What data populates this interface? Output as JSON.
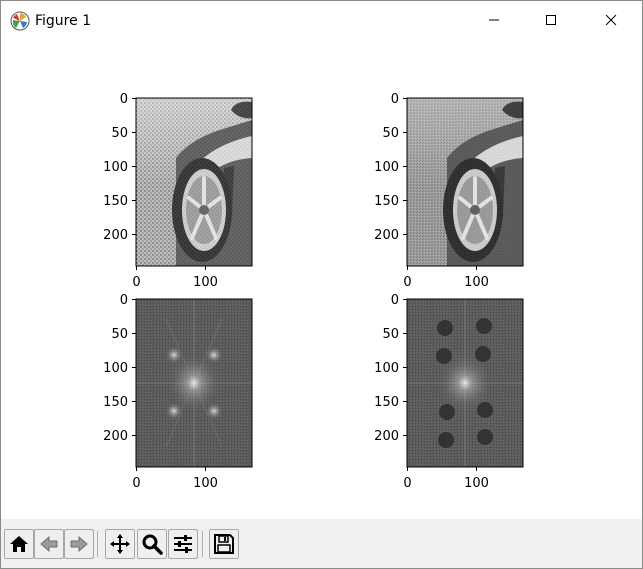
{
  "window": {
    "title": "Figure 1",
    "icons": {
      "app": "matplotlib-logo-icon",
      "minimize": "minimize-icon",
      "maximize": "maximize-icon",
      "close": "close-icon"
    }
  },
  "figure": {
    "subplots": [
      {
        "id": "original-image",
        "content": "grayscale photo of a car wheel with halftone noise pattern",
        "xticks": [
          "0",
          "100"
        ],
        "yticks": [
          "0",
          "50",
          "100",
          "150",
          "200"
        ]
      },
      {
        "id": "filtered-image",
        "content": "grayscale photo of a car wheel with noise reduced",
        "xticks": [
          "0",
          "100"
        ],
        "yticks": [
          "0",
          "50",
          "100",
          "150",
          "200"
        ]
      },
      {
        "id": "spectrum",
        "content": "Fourier magnitude spectrum with bright peaks",
        "xticks": [
          "0",
          "100"
        ],
        "yticks": [
          "0",
          "50",
          "100",
          "150",
          "200"
        ]
      },
      {
        "id": "masked-spectrum",
        "content": "Fourier spectrum with dark notch-filter circles",
        "xticks": [
          "0",
          "100"
        ],
        "yticks": [
          "0",
          "50",
          "100",
          "150",
          "200"
        ]
      }
    ],
    "colors": {
      "axes": "#000000",
      "background": "#ffffff"
    }
  },
  "toolbar": {
    "buttons": [
      {
        "name": "home-button",
        "icon": "home-icon"
      },
      {
        "name": "back-button",
        "icon": "back-arrow-icon"
      },
      {
        "name": "forward-button",
        "icon": "forward-arrow-icon"
      },
      {
        "name": "pan-button",
        "icon": "move-icon"
      },
      {
        "name": "zoom-button",
        "icon": "zoom-icon"
      },
      {
        "name": "configure-subplots-button",
        "icon": "sliders-icon"
      },
      {
        "name": "save-button",
        "icon": "save-icon"
      }
    ]
  }
}
